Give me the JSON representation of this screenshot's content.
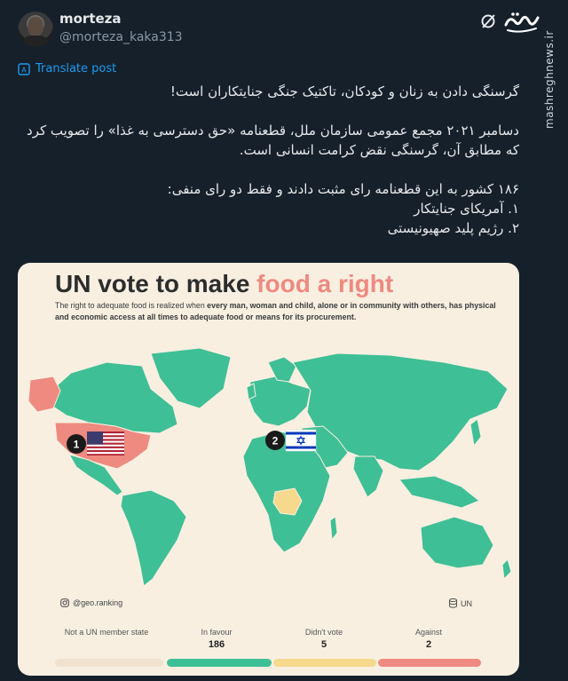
{
  "user": {
    "display_name": "morteza",
    "handle": "@morteza_kaka313"
  },
  "header": {
    "icon": "grok-icon",
    "brand": "mashreghnews-logo"
  },
  "watermark": "mashreghnews.ir",
  "translate_label": "Translate post",
  "post": {
    "line1": "گرسنگی دادن به زنان و کودکان، تاکتیک جنگی جنایتکاران است!",
    "line2": "دسامبر ۲۰۲۱ مجمع عمومی سازمان ملل، قطعنامه «حق دسترسی به غذا» را تصویب کرد که مطابق آن، گرسنگی نقض کرامت انسانی است.",
    "line3": "۱۸۶ کشور به این قطعنامه رای مثبت دادند و فقط دو رای منفی:",
    "line4": "۱. آمریکای جنایتکار",
    "line5": "۲. رژیم پلید صهیونیستی"
  },
  "card": {
    "title_main": "UN vote to make ",
    "title_accent": "food a right",
    "subtitle_1": "The right to adequate food is realized when ",
    "subtitle_bold": "every man, woman and child, alone or in community with others, has physical and economic access at all times to adequate food or means for its procurement.",
    "credit": "@geo.ranking",
    "source": "UN",
    "markers": {
      "usa": "1",
      "israel": "2"
    },
    "colors": {
      "in_favour": "#3fbf95",
      "against": "#ee8a80",
      "didnt_vote": "#f7d98e",
      "not_member": "#f0e2cf",
      "background": "#f8efe1"
    },
    "legend": [
      {
        "label": "Not a UN member state",
        "value": ""
      },
      {
        "label": "In favour",
        "value": "186"
      },
      {
        "label": "Didn't vote",
        "value": "5"
      },
      {
        "label": "Against",
        "value": "2"
      }
    ]
  }
}
